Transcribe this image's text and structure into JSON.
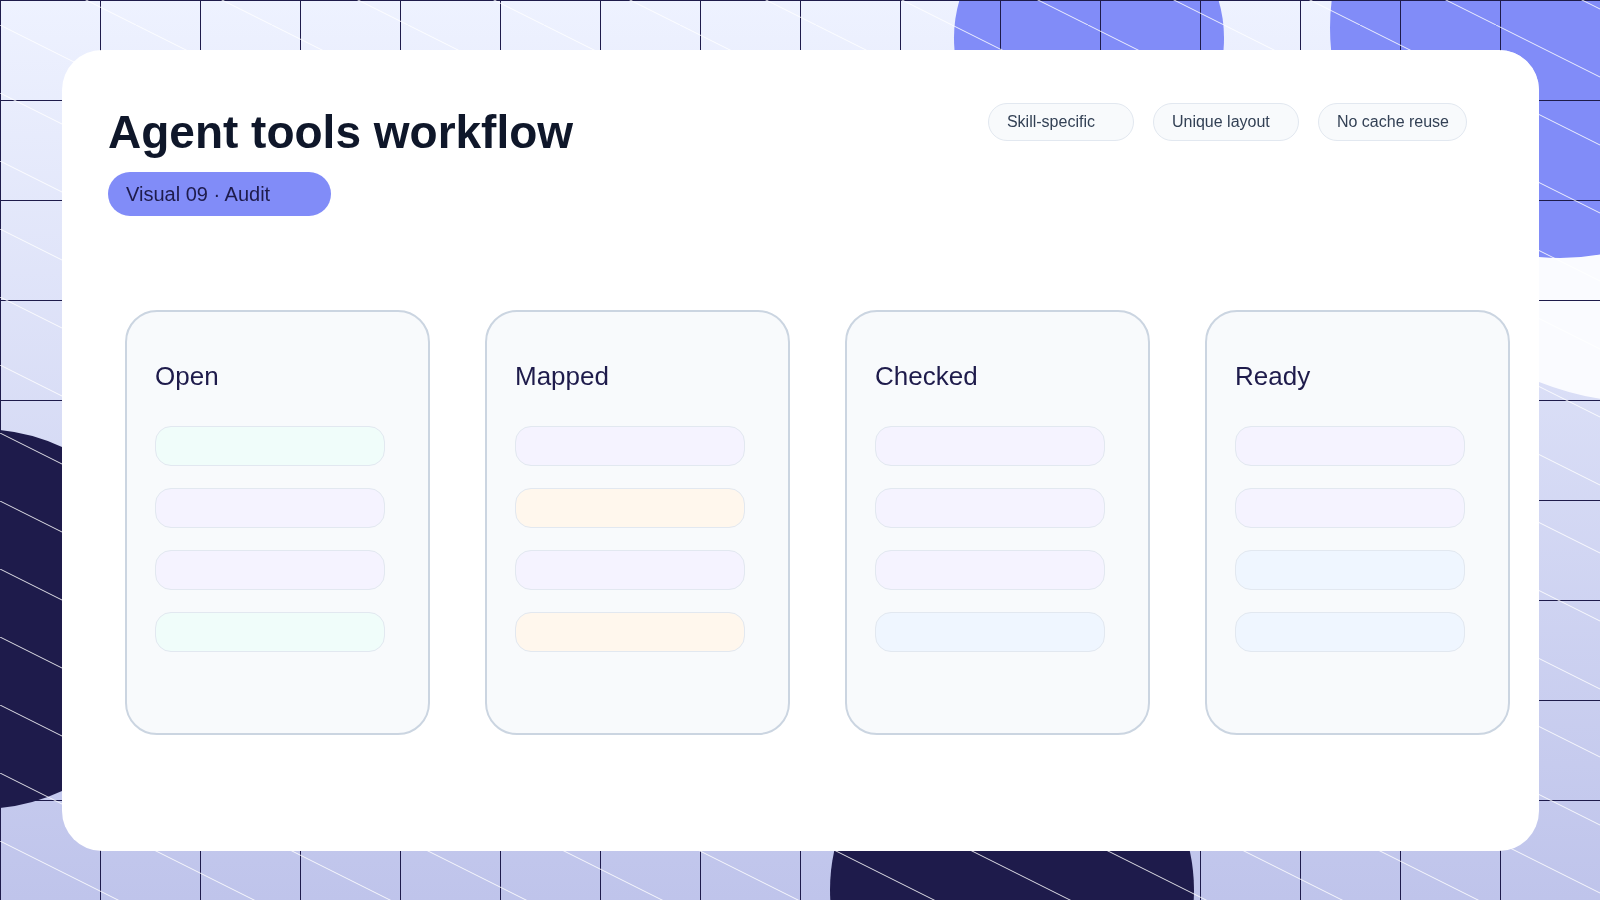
{
  "title": "Agent tools workflow",
  "badge": "Visual 09 · Audit",
  "tags": [
    "Skill-specific",
    "Unique layout",
    "No cache reuse"
  ],
  "columns": [
    {
      "title": "Open",
      "items": [
        {
          "color": "#f0fdfa"
        },
        {
          "color": "#f5f3ff"
        },
        {
          "color": "#f5f3ff"
        },
        {
          "color": "#f0fdfa"
        }
      ]
    },
    {
      "title": "Mapped",
      "items": [
        {
          "color": "#f5f3ff"
        },
        {
          "color": "#fff7ed"
        },
        {
          "color": "#f5f3ff"
        },
        {
          "color": "#fff7ed"
        }
      ]
    },
    {
      "title": "Checked",
      "items": [
        {
          "color": "#f5f3ff"
        },
        {
          "color": "#f5f3ff"
        },
        {
          "color": "#f5f3ff"
        },
        {
          "color": "#eff6ff"
        }
      ]
    },
    {
      "title": "Ready",
      "items": [
        {
          "color": "#f5f3ff"
        },
        {
          "color": "#f5f3ff"
        },
        {
          "color": "#eff6ff"
        },
        {
          "color": "#eff6ff"
        }
      ]
    }
  ]
}
